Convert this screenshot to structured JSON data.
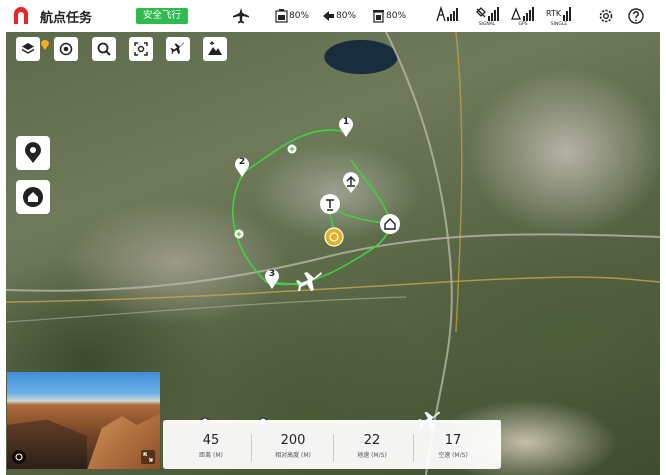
{
  "header": {
    "title": "航点任务",
    "status_badge": "安全飞行",
    "batteries": [
      {
        "value": "80%",
        "icon": "battery-1-icon"
      },
      {
        "value": "80%",
        "icon": "battery-2-icon"
      },
      {
        "value": "80%",
        "icon": "battery-3-icon"
      }
    ],
    "signals": [
      {
        "label": "",
        "icon": "signal-icon"
      },
      {
        "label": "SIGNAL",
        "icon": "satellite-signal-icon"
      },
      {
        "label": "GPS",
        "icon": "gps-signal-icon"
      },
      {
        "label": "SINGLE",
        "icon": "rtk-signal-icon"
      }
    ]
  },
  "map": {
    "waypoints": [
      "1",
      "2",
      "3"
    ]
  },
  "telemetry": [
    {
      "value": "45",
      "label": "距离 (M)"
    },
    {
      "value": "200",
      "label": "相对高度 (M)"
    },
    {
      "value": "22",
      "label": "地速 (M/S)"
    },
    {
      "value": "17",
      "label": "空速 (M/S)"
    }
  ],
  "colors": {
    "accent": "#e8262a",
    "badge": "#2fbb4f",
    "route": "#3fd23f"
  }
}
